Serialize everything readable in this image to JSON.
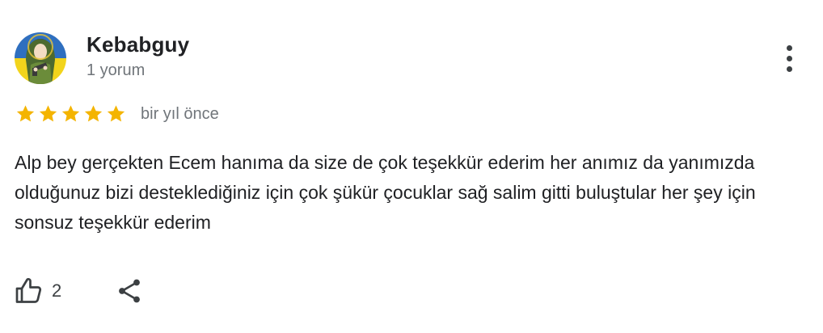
{
  "author": {
    "name": "Kebabguy",
    "meta": "1 yorum"
  },
  "rating": {
    "stars": 5,
    "max": 5,
    "date": "bir yıl önce",
    "star_color": "#f4b400"
  },
  "review": {
    "text": "Alp bey gerçekten Ecem hanıma da size de çok teşekkür ederim her anımız da yanımızda olduğunuz bizi desteklediğiniz için çok şükür çocuklar sağ salim gitti buluştular her şey için sonsuz teşekkür ederim"
  },
  "actions": {
    "like_count": "2",
    "like_icon": "thumb-up-icon",
    "share_icon": "share-icon",
    "more_icon": "more-vert-icon"
  },
  "colors": {
    "text_primary": "#202124",
    "text_secondary": "#70757a",
    "icon": "#3c4043"
  }
}
